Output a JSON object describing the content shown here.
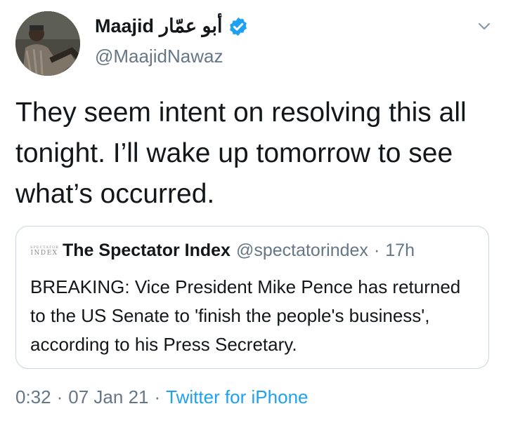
{
  "author": {
    "name": "Maajid",
    "arabic_name": "أبو عمّار",
    "handle": "@MaajidNawaz",
    "verified": true
  },
  "tweet": {
    "text": "They seem intent on resolving this all tonight. I’ll wake up tomorrow to see what’s occurred."
  },
  "quoted_tweet": {
    "logo_line1": "SPECTATOR",
    "logo_line2": "INDEX",
    "name": "The Spectator Index",
    "handle": "@spectatorindex",
    "separator": "·",
    "time": "17h",
    "text": "BREAKING: Vice President Mike Pence has returned to the US Senate to 'finish the people's business', according to his Press Secretary."
  },
  "meta": {
    "time": "0:32",
    "separator1": "·",
    "date": "07 Jan 21",
    "separator2": "·",
    "source": "Twitter for iPhone"
  },
  "colors": {
    "text": "#14171a",
    "secondary": "#657786",
    "accent": "#1da1f2",
    "border": "#ccd6dd"
  },
  "icons": {
    "verified": "verified-badge-icon",
    "more": "chevron-down-icon"
  }
}
